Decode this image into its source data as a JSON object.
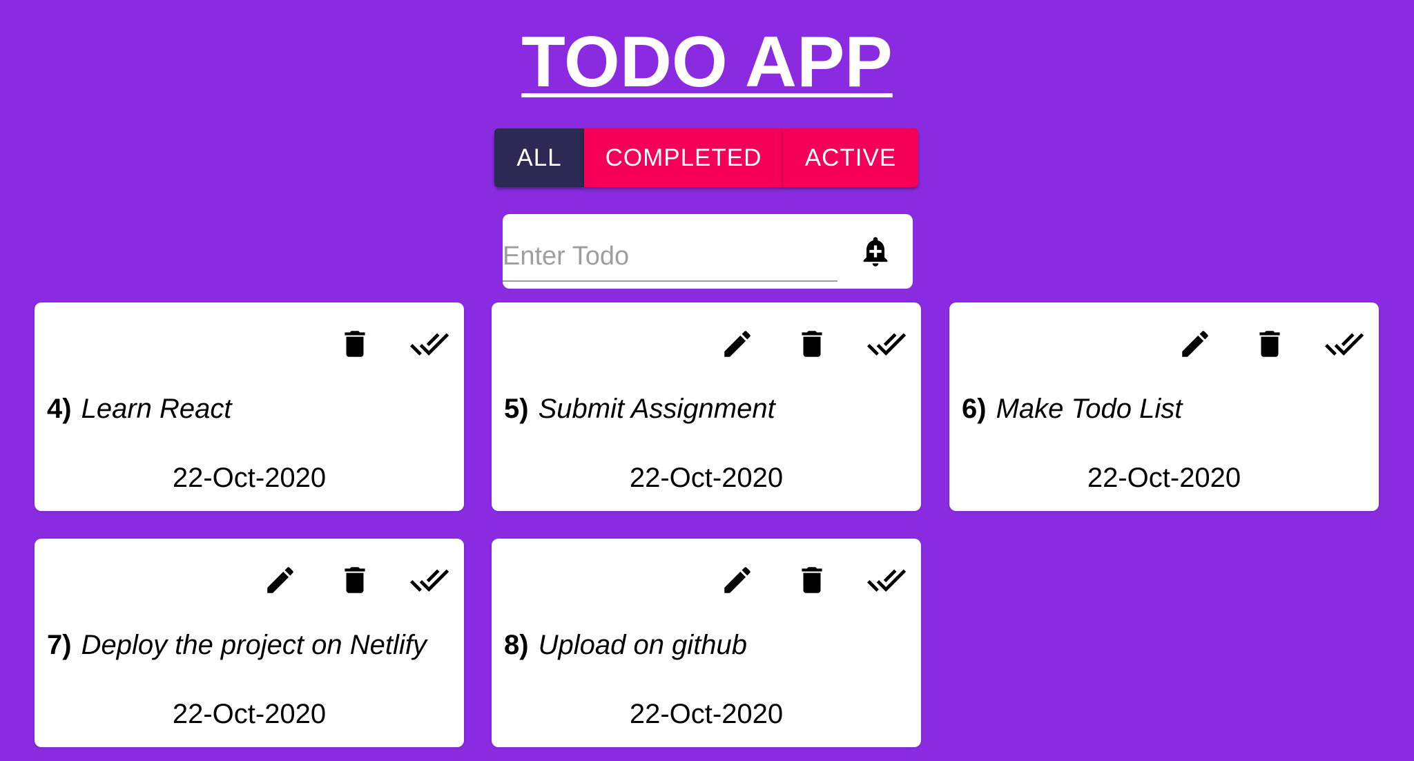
{
  "app": {
    "title": "TODO APP"
  },
  "filters": {
    "all": "ALL",
    "completed": "COMPLETED",
    "active": "ACTIVE"
  },
  "input": {
    "placeholder": "Enter Todo",
    "value": ""
  },
  "colors": {
    "background": "#8a2be2",
    "filter_selected": "#2c2a54",
    "filter_unselected": "#f50057",
    "card": "#ffffff"
  },
  "icons": {
    "add": "bell-plus-icon",
    "edit": "pencil-icon",
    "delete": "trash-icon",
    "complete": "double-check-icon"
  },
  "todos": [
    {
      "num": "4)",
      "text": "Learn React",
      "date": "22-Oct-2020"
    },
    {
      "num": "5)",
      "text": "Submit Assignment",
      "date": "22-Oct-2020"
    },
    {
      "num": "6)",
      "text": "Make Todo List",
      "date": "22-Oct-2020"
    },
    {
      "num": "7)",
      "text": "Deploy the project on Netlify",
      "date": "22-Oct-2020"
    },
    {
      "num": "8)",
      "text": "Upload on github",
      "date": "22-Oct-2020"
    }
  ]
}
